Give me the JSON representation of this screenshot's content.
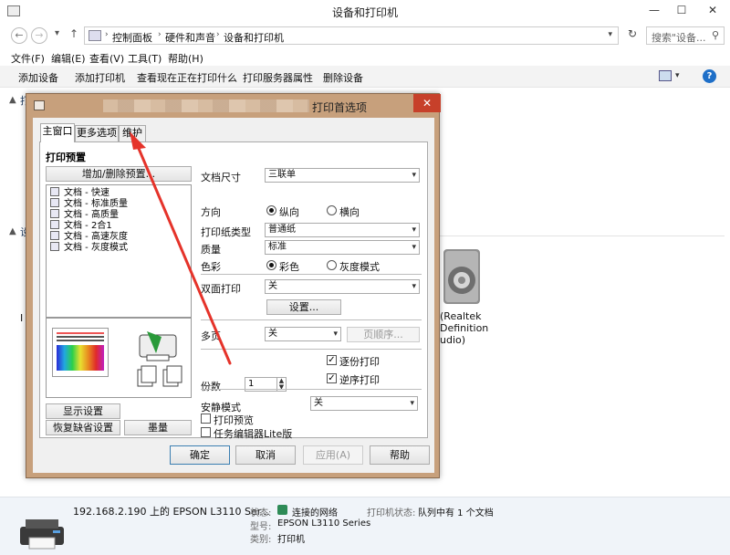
{
  "window": {
    "title": "设备和打印机",
    "min": "—",
    "max": "☐",
    "close": "✕"
  },
  "nav": {
    "back": "←",
    "forward": "→",
    "recent": "▾",
    "up": "↑",
    "breadcrumb": [
      "控制面板",
      "硬件和声音",
      "设备和打印机"
    ],
    "sep": "›",
    "refresh": "↻",
    "search_placeholder": "搜索\"设备...",
    "search_icon": "⚲"
  },
  "menu": [
    "文件(F)",
    "编辑(E)",
    "查看(V)",
    "工具(T)",
    "帮助(H)"
  ],
  "commands": [
    "添加设备",
    "添加打印机",
    "查看现在正在打印什么",
    "打印服务器属性",
    "删除设备"
  ],
  "view_drop": "▾",
  "help": "?",
  "content": {
    "group1_partial": "打",
    "group2_partial": "设",
    "tri": "▲",
    "partial_letter": "I",
    "speaker_lines": [
      "(Realtek",
      "Definition",
      "udio)"
    ]
  },
  "details": {
    "name": "192.168.2.190 上的 EPSON L3110 Ser...",
    "status_label": "状态:",
    "status_value": "连接的网络",
    "printer_status_label": "打印机状态:",
    "printer_status_value": "队列中有 1 个文档",
    "model_label": "型号:",
    "model_value": "EPSON L3110 Series",
    "category_label": "类别:",
    "category_value": "打印机"
  },
  "dialog": {
    "title_suffix": "打印首选项",
    "close": "✕",
    "tabs": [
      "主窗口",
      "更多选项",
      "维护"
    ],
    "presets_title": "打印预置",
    "add_remove_btn": "增加/删除预置...",
    "presets": [
      "文档 - 快速",
      "文档 - 标准质量",
      "文档 - 高质量",
      "文档 - 2合1",
      "文档 - 高速灰度",
      "文档 - 灰度模式"
    ],
    "show_settings_btn": "显示设置",
    "restore_defaults_btn": "恢复缺省设置",
    "ink_btn": "墨量",
    "paper_size_label": "文档尺寸",
    "paper_size_value": "三联单",
    "orientation_label": "方向",
    "portrait": "纵向",
    "landscape": "横向",
    "paper_type_label": "打印纸类型",
    "paper_type_value": "普通纸",
    "quality_label": "质量",
    "quality_value": "标准",
    "color_label": "色彩",
    "color_option": "彩色",
    "grayscale_option": "灰度模式",
    "duplex_label": "双面打印",
    "duplex_value": "关",
    "settings_btn": "设置...",
    "multipage_label": "多页",
    "multipage_value": "关",
    "page_order_btn": "页顺序...",
    "copies_label": "份数",
    "copies_value": "1",
    "collate": "逐份打印",
    "reverse": "逆序打印",
    "quiet_label": "安静模式",
    "quiet_value": "关",
    "print_preview": "打印预览",
    "job_arranger": "任务编辑器Lite版",
    "check_mark": "✓",
    "spin_up": "▲",
    "spin_down": "▼",
    "dropdown_arrow": "▾",
    "ok": "确定",
    "cancel": "取消",
    "apply": "应用(A)",
    "help": "帮助"
  },
  "annotation_color": "#e5332a"
}
